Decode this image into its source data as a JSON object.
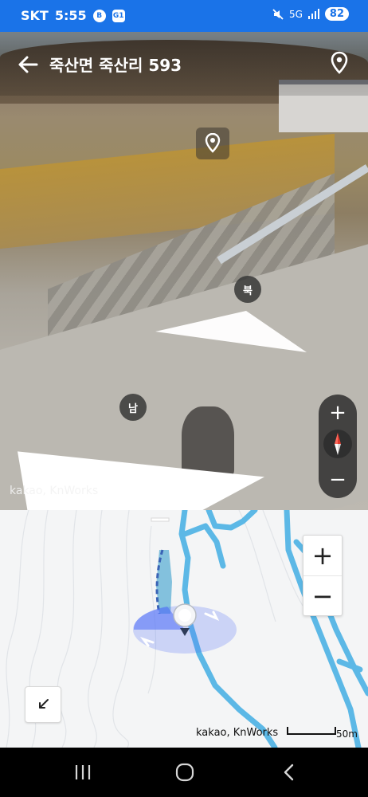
{
  "status_bar": {
    "carrier": "SKT",
    "time": "5:55",
    "badge_1": "B",
    "badge_2": "G1",
    "network": "5G",
    "battery": "82"
  },
  "header": {
    "title": "죽산면 죽산리 593"
  },
  "roadview": {
    "north_label": "북",
    "south_label": "남",
    "attribution": "kakao, KnWorks",
    "zoom_in": "+",
    "zoom_out": "−"
  },
  "map": {
    "zoom_in": "+",
    "zoom_out": "−",
    "attribution": "kakao, KnWorks",
    "scale": "50m"
  },
  "colors": {
    "status_bar": "#1a73e8",
    "road": "#5cb8e6",
    "view_cone": "#4f6ef7"
  }
}
